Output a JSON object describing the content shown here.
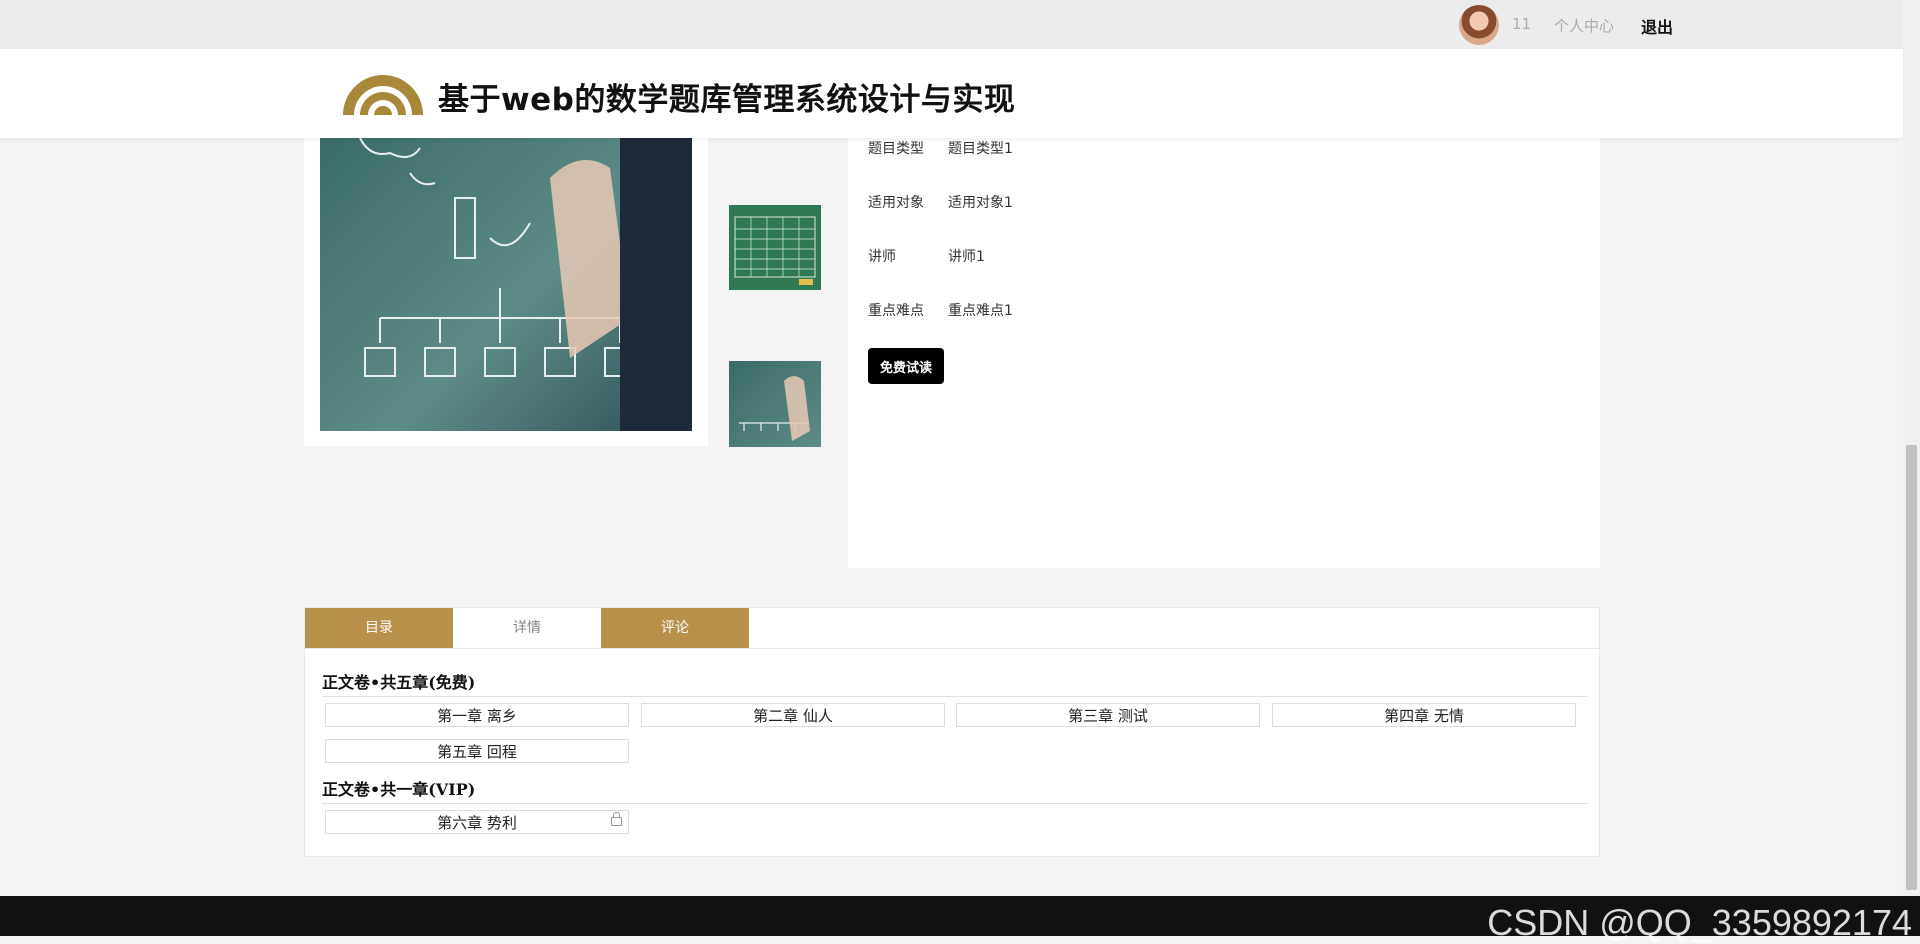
{
  "topbar": {
    "user_count": "11",
    "personal_center": "个人中心",
    "logout": "退出"
  },
  "header": {
    "title": "基于web的数学题库管理系统设计与实现",
    "logo_color": "#a8893a"
  },
  "product": {
    "info": [
      {
        "label": "题目类型",
        "value": "题目类型1"
      },
      {
        "label": "适用对象",
        "value": "适用对象1"
      },
      {
        "label": "讲师",
        "value": "讲师1"
      },
      {
        "label": "重点难点",
        "value": "重点难点1"
      }
    ],
    "trial_button": "免费试读"
  },
  "tabs": [
    {
      "label": "目录",
      "state": "active"
    },
    {
      "label": "详情",
      "state": "plain"
    },
    {
      "label": "评论",
      "state": "active"
    }
  ],
  "volumes": [
    {
      "title": "正文卷•共五章(免费)",
      "chapters": [
        "第一章 离乡",
        "第二章 仙人",
        "第三章 测试",
        "第四章 无情",
        "第五章 回程"
      ]
    },
    {
      "title": "正文卷•共一章(VIP)",
      "chapters": [
        "第六章 势利"
      ]
    }
  ],
  "watermark": "CSDN @QQ_3359892174",
  "colors": {
    "accent": "#b8914a",
    "button": "#000000",
    "page_bg": "#f4f4f4"
  }
}
